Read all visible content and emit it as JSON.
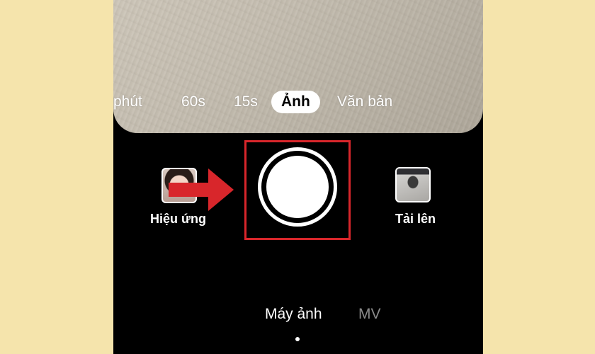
{
  "capture_modes": [
    {
      "label": "phút",
      "active": false
    },
    {
      "label": "60s",
      "active": false
    },
    {
      "label": "15s",
      "active": false
    },
    {
      "label": "Ảnh",
      "active": true
    },
    {
      "label": "Văn bản",
      "active": false
    }
  ],
  "effects": {
    "label": "Hiệu ứng"
  },
  "upload": {
    "label": "Tải lên"
  },
  "bottom_tabs": [
    {
      "label": "Máy ảnh",
      "active": true
    },
    {
      "label": "MV",
      "active": false
    }
  ],
  "colors": {
    "background": "#f5e4ac",
    "annotation": "#d8262b",
    "screen": "#000000",
    "inactive_tab": "#8a8a8a"
  },
  "icons": {
    "shutter": "capture-button",
    "annotation_arrow": "arrow-right-icon"
  }
}
